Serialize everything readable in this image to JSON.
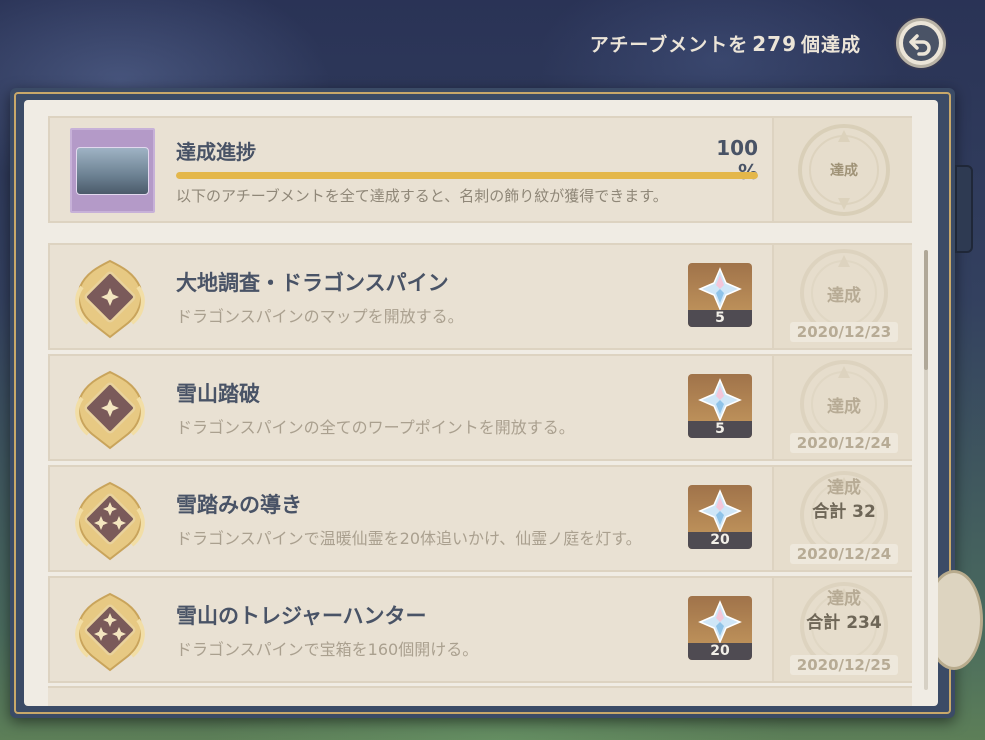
{
  "header": {
    "prefix": "アチーブメントを",
    "count": "279",
    "suffix": "個達成"
  },
  "back_button_icon": "back-arrow-icon",
  "progress": {
    "title": "達成進捗",
    "percent_label": "100 %",
    "percent_value": 100,
    "description": "以下のアチーブメントを全て達成すると、名刺の飾り紋が獲得できます。",
    "stamp_label": "達成"
  },
  "achievements": [
    {
      "title": "大地調査・ドラゴンスパイン",
      "description": "ドラゴンスパインのマップを開放する。",
      "reward_count": "5",
      "status": "達成",
      "total": "",
      "date": "2020/12/23",
      "badge_stars": 1
    },
    {
      "title": "雪山踏破",
      "description": "ドラゴンスパインの全てのワープポイントを開放する。",
      "reward_count": "5",
      "status": "達成",
      "total": "",
      "date": "2020/12/24",
      "badge_stars": 1
    },
    {
      "title": "雪踏みの導き",
      "description": "ドラゴンスパインで温暖仙霊を20体追いかけ、仙霊ノ庭を灯す。",
      "reward_count": "20",
      "status": "達成",
      "total": "合計 32",
      "date": "2020/12/24",
      "badge_stars": 3
    },
    {
      "title": "雪山のトレジャーハンター",
      "description": "ドラゴンスパインで宝箱を160個開ける。",
      "reward_count": "20",
      "status": "達成",
      "total": "合計 234",
      "date": "2020/12/25",
      "badge_stars": 3
    }
  ],
  "colors": {
    "accent_gold": "#e4b74a",
    "title_text": "#495366",
    "desc_text": "#aaa08f",
    "card_bg": "#e9e1d3"
  }
}
